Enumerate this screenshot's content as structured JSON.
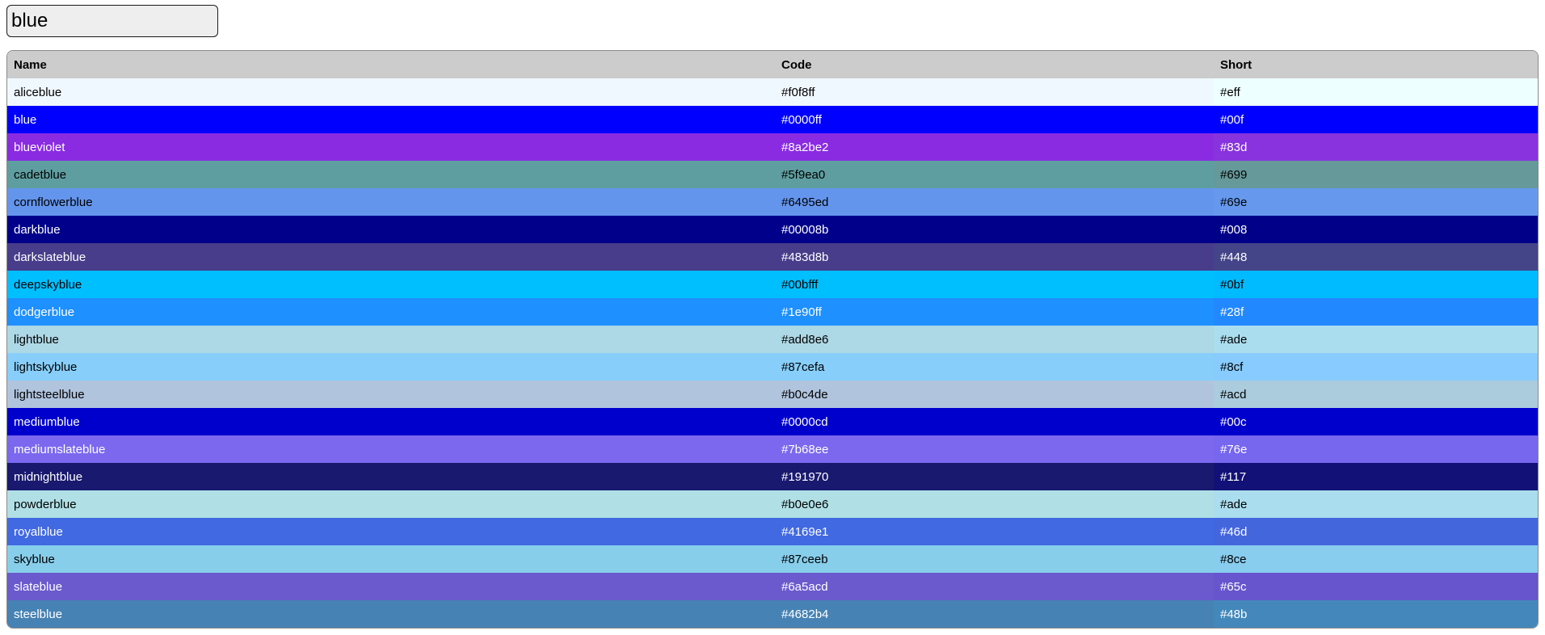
{
  "search": {
    "value": "blue",
    "placeholder": ""
  },
  "table": {
    "headers": {
      "name": "Name",
      "code": "Code",
      "short": "Short"
    },
    "rows": [
      {
        "name": "aliceblue",
        "code": "#f0f8ff",
        "short": "#eff",
        "short_bg": "#eeffff",
        "text_color": "#000000"
      },
      {
        "name": "blue",
        "code": "#0000ff",
        "short": "#00f",
        "short_bg": "#0000ff",
        "text_color": "#ffffff"
      },
      {
        "name": "blueviolet",
        "code": "#8a2be2",
        "short": "#83d",
        "short_bg": "#8833dd",
        "text_color": "#ffffff"
      },
      {
        "name": "cadetblue",
        "code": "#5f9ea0",
        "short": "#699",
        "short_bg": "#669999",
        "text_color": "#000000"
      },
      {
        "name": "cornflowerblue",
        "code": "#6495ed",
        "short": "#69e",
        "short_bg": "#6699ee",
        "text_color": "#000000"
      },
      {
        "name": "darkblue",
        "code": "#00008b",
        "short": "#008",
        "short_bg": "#000088",
        "text_color": "#ffffff"
      },
      {
        "name": "darkslateblue",
        "code": "#483d8b",
        "short": "#448",
        "short_bg": "#444488",
        "text_color": "#ffffff"
      },
      {
        "name": "deepskyblue",
        "code": "#00bfff",
        "short": "#0bf",
        "short_bg": "#00bbff",
        "text_color": "#000000"
      },
      {
        "name": "dodgerblue",
        "code": "#1e90ff",
        "short": "#28f",
        "short_bg": "#2288ff",
        "text_color": "#ffffff"
      },
      {
        "name": "lightblue",
        "code": "#add8e6",
        "short": "#ade",
        "short_bg": "#aaddee",
        "text_color": "#000000"
      },
      {
        "name": "lightskyblue",
        "code": "#87cefa",
        "short": "#8cf",
        "short_bg": "#88ccff",
        "text_color": "#000000"
      },
      {
        "name": "lightsteelblue",
        "code": "#b0c4de",
        "short": "#acd",
        "short_bg": "#aaccdd",
        "text_color": "#000000"
      },
      {
        "name": "mediumblue",
        "code": "#0000cd",
        "short": "#00c",
        "short_bg": "#0000cc",
        "text_color": "#ffffff"
      },
      {
        "name": "mediumslateblue",
        "code": "#7b68ee",
        "short": "#76e",
        "short_bg": "#7766ee",
        "text_color": "#ffffff"
      },
      {
        "name": "midnightblue",
        "code": "#191970",
        "short": "#117",
        "short_bg": "#111177",
        "text_color": "#ffffff"
      },
      {
        "name": "powderblue",
        "code": "#b0e0e6",
        "short": "#ade",
        "short_bg": "#aaddee",
        "text_color": "#000000"
      },
      {
        "name": "royalblue",
        "code": "#4169e1",
        "short": "#46d",
        "short_bg": "#4466dd",
        "text_color": "#ffffff"
      },
      {
        "name": "skyblue",
        "code": "#87ceeb",
        "short": "#8ce",
        "short_bg": "#88ccee",
        "text_color": "#000000"
      },
      {
        "name": "slateblue",
        "code": "#6a5acd",
        "short": "#65c",
        "short_bg": "#6655cc",
        "text_color": "#ffffff"
      },
      {
        "name": "steelblue",
        "code": "#4682b4",
        "short": "#48b",
        "short_bg": "#4488bb",
        "text_color": "#ffffff"
      }
    ]
  }
}
